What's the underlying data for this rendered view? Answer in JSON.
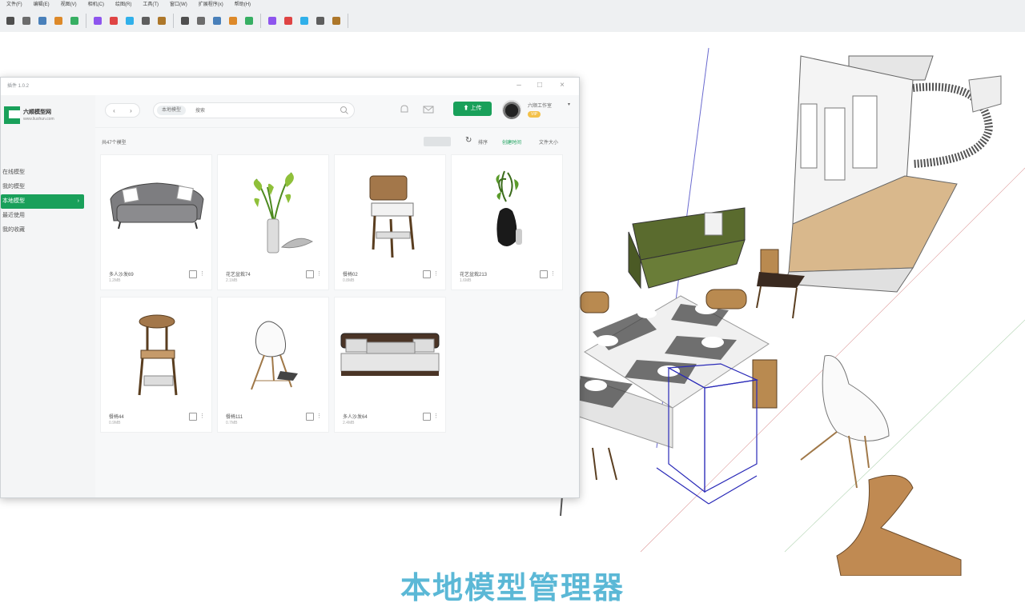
{
  "menubar": [
    "文件(F)",
    "编辑(E)",
    "视图(V)",
    "相机(C)",
    "绘图(R)",
    "工具(T)",
    "窗口(W)",
    "扩展程序(x)",
    "帮助(H)"
  ],
  "toolbar_icons": [
    "select-icon",
    "eraser-icon",
    "paint-icon",
    "line-icon",
    "rectangle-icon",
    "circle-icon",
    "push-pull-icon",
    "move-icon",
    "rotate-icon",
    "scale-icon",
    "offset-icon",
    "tape-icon",
    "dimension-icon",
    "text-icon",
    "axes-icon",
    "orbit-icon",
    "pan-icon",
    "zoom-icon",
    "zoom-extents-icon",
    "section-icon"
  ],
  "plugin": {
    "title": "插件 1.0.2",
    "logo_text": "六顺模型网",
    "logo_sub": "www.liushun.com",
    "nav": [
      {
        "label": "在线模型",
        "active": false
      },
      {
        "label": "我的模型",
        "active": false
      },
      {
        "label": "本地模型",
        "active": true
      },
      {
        "label": "最近使用",
        "active": false
      },
      {
        "label": "我的收藏",
        "active": false
      }
    ],
    "search_tag": "本地模型",
    "search_placeholder": "搜索",
    "upload_label": "上传",
    "username": "六顺工作室",
    "badge": "VIP",
    "crumb": "共47个模型",
    "sort_label": "排序",
    "sort_options": [
      "创建时间",
      "文件大小"
    ],
    "cards": [
      {
        "name": "多人沙发69",
        "size": "1.2MB",
        "kind": "sofa"
      },
      {
        "name": "花艺盆栽74",
        "size": "2.1MB",
        "kind": "plant"
      },
      {
        "name": "餐椅02",
        "size": "0.8MB",
        "kind": "chair-rush"
      },
      {
        "name": "花艺盆栽213",
        "size": "1.6MB",
        "kind": "vase"
      },
      {
        "name": "餐椅44",
        "size": "0.9MB",
        "kind": "chair-round"
      },
      {
        "name": "餐椅111",
        "size": "0.7MB",
        "kind": "shell-chair"
      },
      {
        "name": "多人沙发64",
        "size": "2.4MB",
        "kind": "sofa2"
      }
    ]
  },
  "subtitle": "本地模型管理器"
}
